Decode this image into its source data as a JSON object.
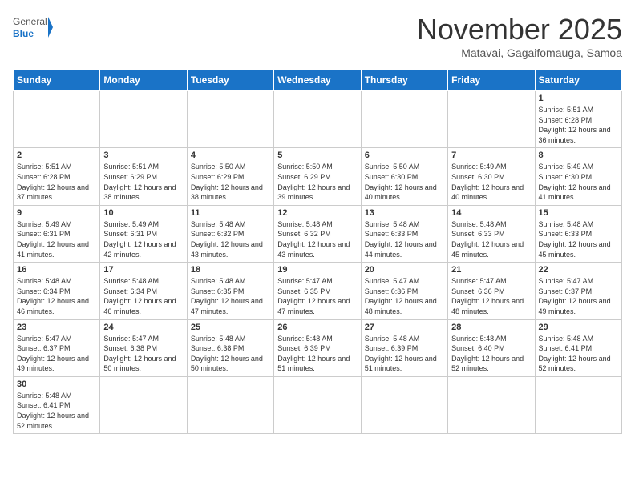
{
  "logo": {
    "text_general": "General",
    "text_blue": "Blue"
  },
  "header": {
    "month": "November 2025",
    "location": "Matavai, Gagaifomauga, Samoa"
  },
  "weekdays": [
    "Sunday",
    "Monday",
    "Tuesday",
    "Wednesday",
    "Thursday",
    "Friday",
    "Saturday"
  ],
  "weeks": [
    [
      {
        "day": "",
        "info": "",
        "empty": true
      },
      {
        "day": "",
        "info": "",
        "empty": true
      },
      {
        "day": "",
        "info": "",
        "empty": true
      },
      {
        "day": "",
        "info": "",
        "empty": true
      },
      {
        "day": "",
        "info": "",
        "empty": true
      },
      {
        "day": "",
        "info": "",
        "empty": true
      },
      {
        "day": "1",
        "info": "Sunrise: 5:51 AM\nSunset: 6:28 PM\nDaylight: 12 hours and 36 minutes."
      }
    ],
    [
      {
        "day": "2",
        "info": "Sunrise: 5:51 AM\nSunset: 6:28 PM\nDaylight: 12 hours and 37 minutes."
      },
      {
        "day": "3",
        "info": "Sunrise: 5:51 AM\nSunset: 6:29 PM\nDaylight: 12 hours and 38 minutes."
      },
      {
        "day": "4",
        "info": "Sunrise: 5:50 AM\nSunset: 6:29 PM\nDaylight: 12 hours and 38 minutes."
      },
      {
        "day": "5",
        "info": "Sunrise: 5:50 AM\nSunset: 6:29 PM\nDaylight: 12 hours and 39 minutes."
      },
      {
        "day": "6",
        "info": "Sunrise: 5:50 AM\nSunset: 6:30 PM\nDaylight: 12 hours and 40 minutes."
      },
      {
        "day": "7",
        "info": "Sunrise: 5:49 AM\nSunset: 6:30 PM\nDaylight: 12 hours and 40 minutes."
      },
      {
        "day": "8",
        "info": "Sunrise: 5:49 AM\nSunset: 6:30 PM\nDaylight: 12 hours and 41 minutes."
      }
    ],
    [
      {
        "day": "9",
        "info": "Sunrise: 5:49 AM\nSunset: 6:31 PM\nDaylight: 12 hours and 41 minutes."
      },
      {
        "day": "10",
        "info": "Sunrise: 5:49 AM\nSunset: 6:31 PM\nDaylight: 12 hours and 42 minutes."
      },
      {
        "day": "11",
        "info": "Sunrise: 5:48 AM\nSunset: 6:32 PM\nDaylight: 12 hours and 43 minutes."
      },
      {
        "day": "12",
        "info": "Sunrise: 5:48 AM\nSunset: 6:32 PM\nDaylight: 12 hours and 43 minutes."
      },
      {
        "day": "13",
        "info": "Sunrise: 5:48 AM\nSunset: 6:33 PM\nDaylight: 12 hours and 44 minutes."
      },
      {
        "day": "14",
        "info": "Sunrise: 5:48 AM\nSunset: 6:33 PM\nDaylight: 12 hours and 45 minutes."
      },
      {
        "day": "15",
        "info": "Sunrise: 5:48 AM\nSunset: 6:33 PM\nDaylight: 12 hours and 45 minutes."
      }
    ],
    [
      {
        "day": "16",
        "info": "Sunrise: 5:48 AM\nSunset: 6:34 PM\nDaylight: 12 hours and 46 minutes."
      },
      {
        "day": "17",
        "info": "Sunrise: 5:48 AM\nSunset: 6:34 PM\nDaylight: 12 hours and 46 minutes."
      },
      {
        "day": "18",
        "info": "Sunrise: 5:48 AM\nSunset: 6:35 PM\nDaylight: 12 hours and 47 minutes."
      },
      {
        "day": "19",
        "info": "Sunrise: 5:47 AM\nSunset: 6:35 PM\nDaylight: 12 hours and 47 minutes."
      },
      {
        "day": "20",
        "info": "Sunrise: 5:47 AM\nSunset: 6:36 PM\nDaylight: 12 hours and 48 minutes."
      },
      {
        "day": "21",
        "info": "Sunrise: 5:47 AM\nSunset: 6:36 PM\nDaylight: 12 hours and 48 minutes."
      },
      {
        "day": "22",
        "info": "Sunrise: 5:47 AM\nSunset: 6:37 PM\nDaylight: 12 hours and 49 minutes."
      }
    ],
    [
      {
        "day": "23",
        "info": "Sunrise: 5:47 AM\nSunset: 6:37 PM\nDaylight: 12 hours and 49 minutes."
      },
      {
        "day": "24",
        "info": "Sunrise: 5:47 AM\nSunset: 6:38 PM\nDaylight: 12 hours and 50 minutes."
      },
      {
        "day": "25",
        "info": "Sunrise: 5:48 AM\nSunset: 6:38 PM\nDaylight: 12 hours and 50 minutes."
      },
      {
        "day": "26",
        "info": "Sunrise: 5:48 AM\nSunset: 6:39 PM\nDaylight: 12 hours and 51 minutes."
      },
      {
        "day": "27",
        "info": "Sunrise: 5:48 AM\nSunset: 6:39 PM\nDaylight: 12 hours and 51 minutes."
      },
      {
        "day": "28",
        "info": "Sunrise: 5:48 AM\nSunset: 6:40 PM\nDaylight: 12 hours and 52 minutes."
      },
      {
        "day": "29",
        "info": "Sunrise: 5:48 AM\nSunset: 6:41 PM\nDaylight: 12 hours and 52 minutes."
      }
    ],
    [
      {
        "day": "30",
        "info": "Sunrise: 5:48 AM\nSunset: 6:41 PM\nDaylight: 12 hours and 52 minutes."
      },
      {
        "day": "",
        "info": "",
        "empty": true
      },
      {
        "day": "",
        "info": "",
        "empty": true
      },
      {
        "day": "",
        "info": "",
        "empty": true
      },
      {
        "day": "",
        "info": "",
        "empty": true
      },
      {
        "day": "",
        "info": "",
        "empty": true
      },
      {
        "day": "",
        "info": "",
        "empty": true
      }
    ]
  ]
}
